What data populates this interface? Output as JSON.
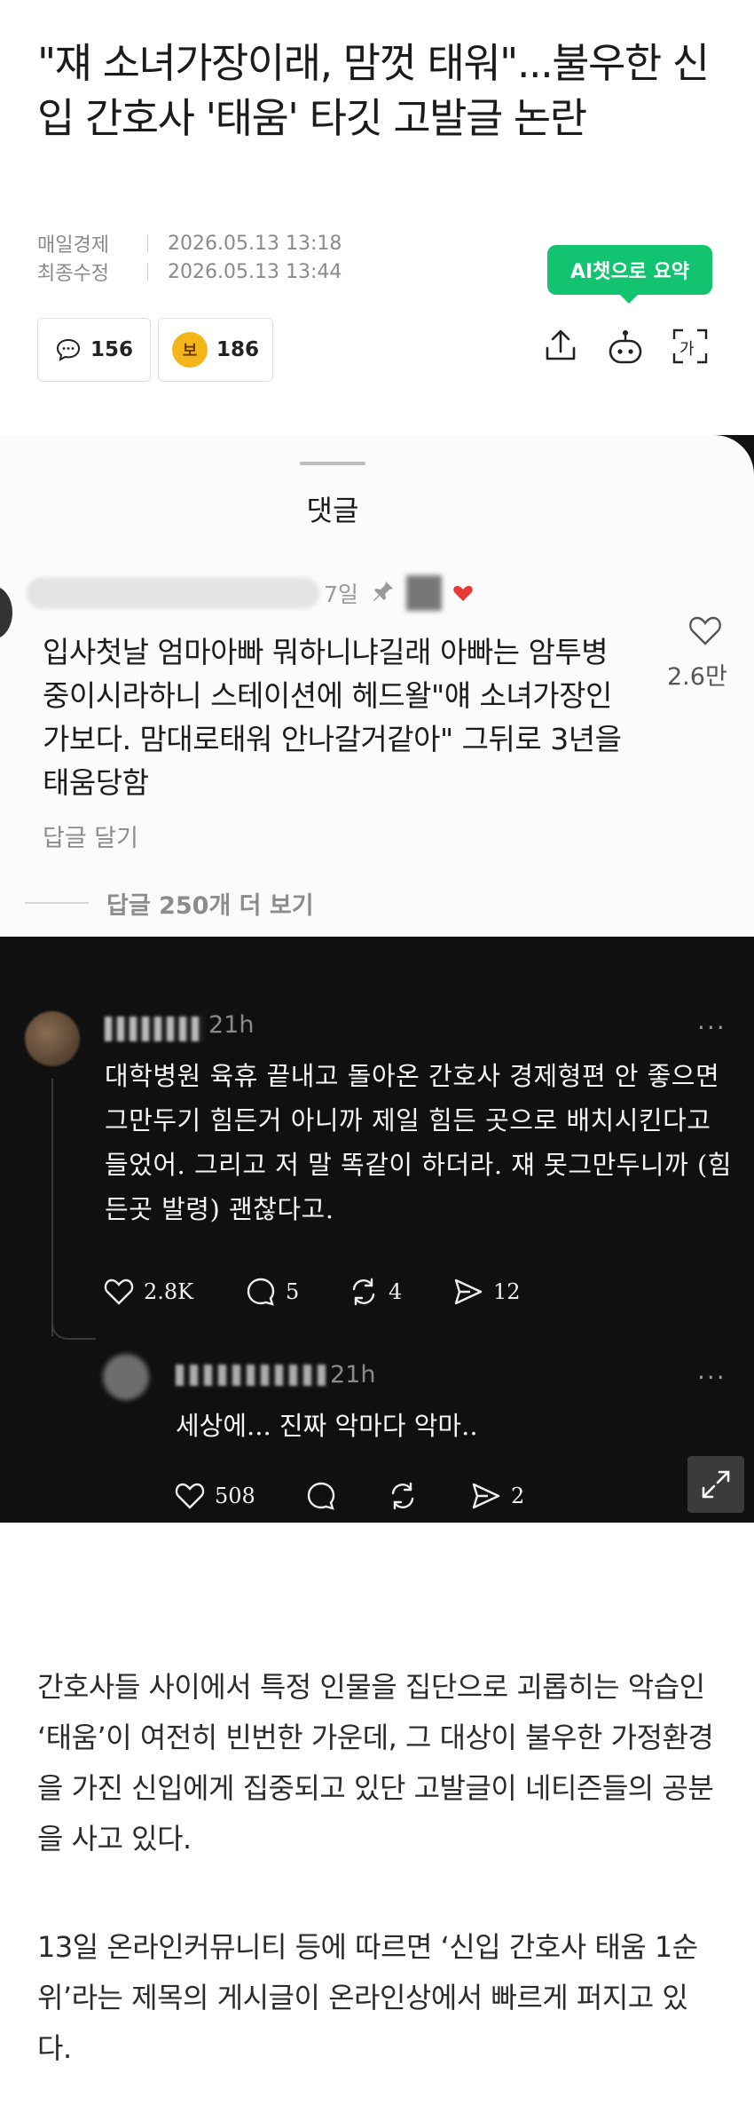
{
  "article": {
    "headline": "\"쟤 소녀가장이래, 맘껏 태워\"...불우한 신입 간호사 '태움' 타깃 고발글 논란",
    "source_label": "매일경제",
    "published": "2026.05.13 13:18",
    "modified_label": "최종수정",
    "modified": "2026.05.13 13:44",
    "ai_summary_label": "AI챗으로 요약",
    "comment_count": "156",
    "reward_coin_glyph": "보",
    "reward_count": "186"
  },
  "screenshot_light": {
    "sheet_title": "댓글",
    "time": "7일",
    "comment": "입사첫날 엄마아빠 뭐하니냐길래 아빠는 암투병중이시라하니 스테이션에 헤드왈\"얘 소녀가장인가보다. 맘대로태워 안나갈거같아\" 그뒤로 3년을 태움당함",
    "like_count": "2.6만",
    "reply_label": "답글 달기",
    "more_replies": "답글 250개 더 보기"
  },
  "screenshot_dark": {
    "post": {
      "time": "21h",
      "text": "대학병원 육휴 끝내고 돌아온 간호사 경제형편 안 좋으면 그만두기 힘든거 아니까 제일 힘든 곳으로 배치시킨다고 들었어. 그리고 저 말 똑같이 하더라. 쟤 못그만두니까 (힘든곳 발령) 괜찮다고.",
      "likes": "2.8K",
      "comments": "5",
      "reposts": "4",
      "shares": "12"
    },
    "reply": {
      "time": "21h",
      "text": "세상에... 진짜 악마다 악마..",
      "likes": "508",
      "shares": "2"
    },
    "more_glyph": "···"
  },
  "body": {
    "paragraph1": "간호사들 사이에서 특정 인물을 집단으로 괴롭히는 악습인 ‘태움’이 여전히 빈번한 가운데, 그 대상이 불우한 가정환경을 가진 신입에게 집중되고 있단 고발글이 네티즌들의 공분을 사고 있다.",
    "paragraph2": "13일 온라인커뮤니티 등에 따르면 ‘신입 간호사 태움 1순위’라는 제목의 게시글이 온라인상에서 빠르게 퍼지고 있다."
  },
  "colors": {
    "accent_green": "#12c36f",
    "coin_gold": "#f3b51a",
    "dark_bg": "#101010"
  },
  "icons": [
    "comment-icon",
    "coin-icon",
    "share-icon",
    "ai-bot-icon",
    "font-size-icon",
    "pin-icon",
    "heart-icon",
    "expand-icon",
    "repost-icon",
    "send-icon"
  ]
}
